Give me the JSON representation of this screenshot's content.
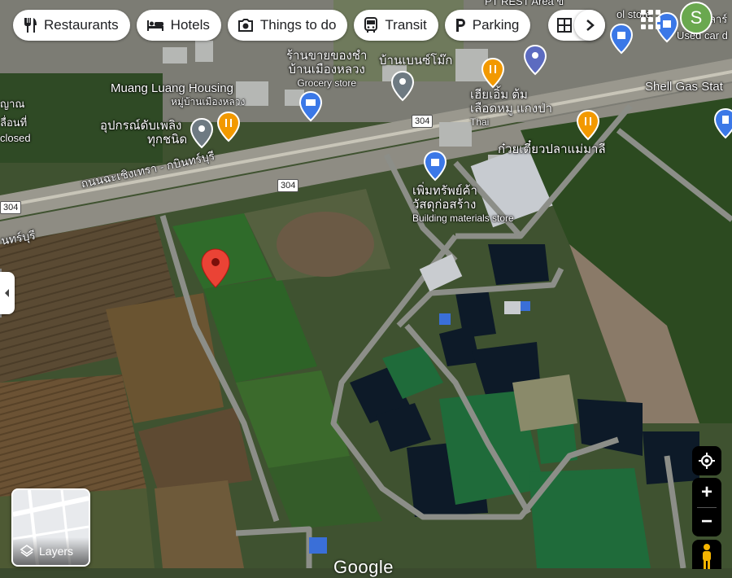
{
  "chips": [
    {
      "label": "Restaurants",
      "icon": "fork-knife-icon"
    },
    {
      "label": "Hotels",
      "icon": "bed-icon"
    },
    {
      "label": "Things to do",
      "icon": "camera-icon"
    },
    {
      "label": "Transit",
      "icon": "bus-icon"
    },
    {
      "label": "Parking",
      "icon": "parking-icon"
    }
  ],
  "account": {
    "initial": "S",
    "color": "#6aa84f"
  },
  "places": {
    "muang_luang": {
      "name": "Muang Luang Housing",
      "sub": "หมู่บ้านเมืองหลวง"
    },
    "fire_equipment": {
      "line1": "อุปกรณ์ดับเพลิง",
      "line2": "ทุกชนิด"
    },
    "grocery": {
      "line1": "ร้านขายของชำ",
      "line2": "บ้านเมืองหลวง",
      "type": "Grocery store"
    },
    "baan_benz": {
      "name": "บ้านเบนซ์โม๊ก"
    },
    "thai_restaurant": {
      "line1": "เฮียเอิ้ม ต้ม",
      "line2": "เลือดหมู แกงป่า",
      "type": "Thai"
    },
    "noodle": {
      "name": "ก๋วยเตี๋ยวปลาแม่มาลี"
    },
    "building_materials": {
      "line1": "เพิ่มทรัพย์ค้า",
      "line2": "วัสดุก่อสร้าง",
      "type": "Building materials store"
    },
    "shell": {
      "name": "Shell Gas Stat"
    },
    "left_edge": {
      "line1": "ญาณ",
      "line2": "ลื่อนที่",
      "line3": "closed"
    },
    "top_partial_1": "PT REST Area ข",
    "top_partial_2": "ol store",
    "used_car": "Used car d",
    "right_partial": "ลาร์"
  },
  "roads": {
    "main_name": "ถนนฉะเชิงเทรา - กบินทร์บุรี",
    "left_partial": "นทร์บุรี",
    "shield": "304"
  },
  "layers": {
    "label": "Layers"
  },
  "map_controls": {
    "zoom_in": "+",
    "zoom_out": "−"
  },
  "attribution": "Google"
}
